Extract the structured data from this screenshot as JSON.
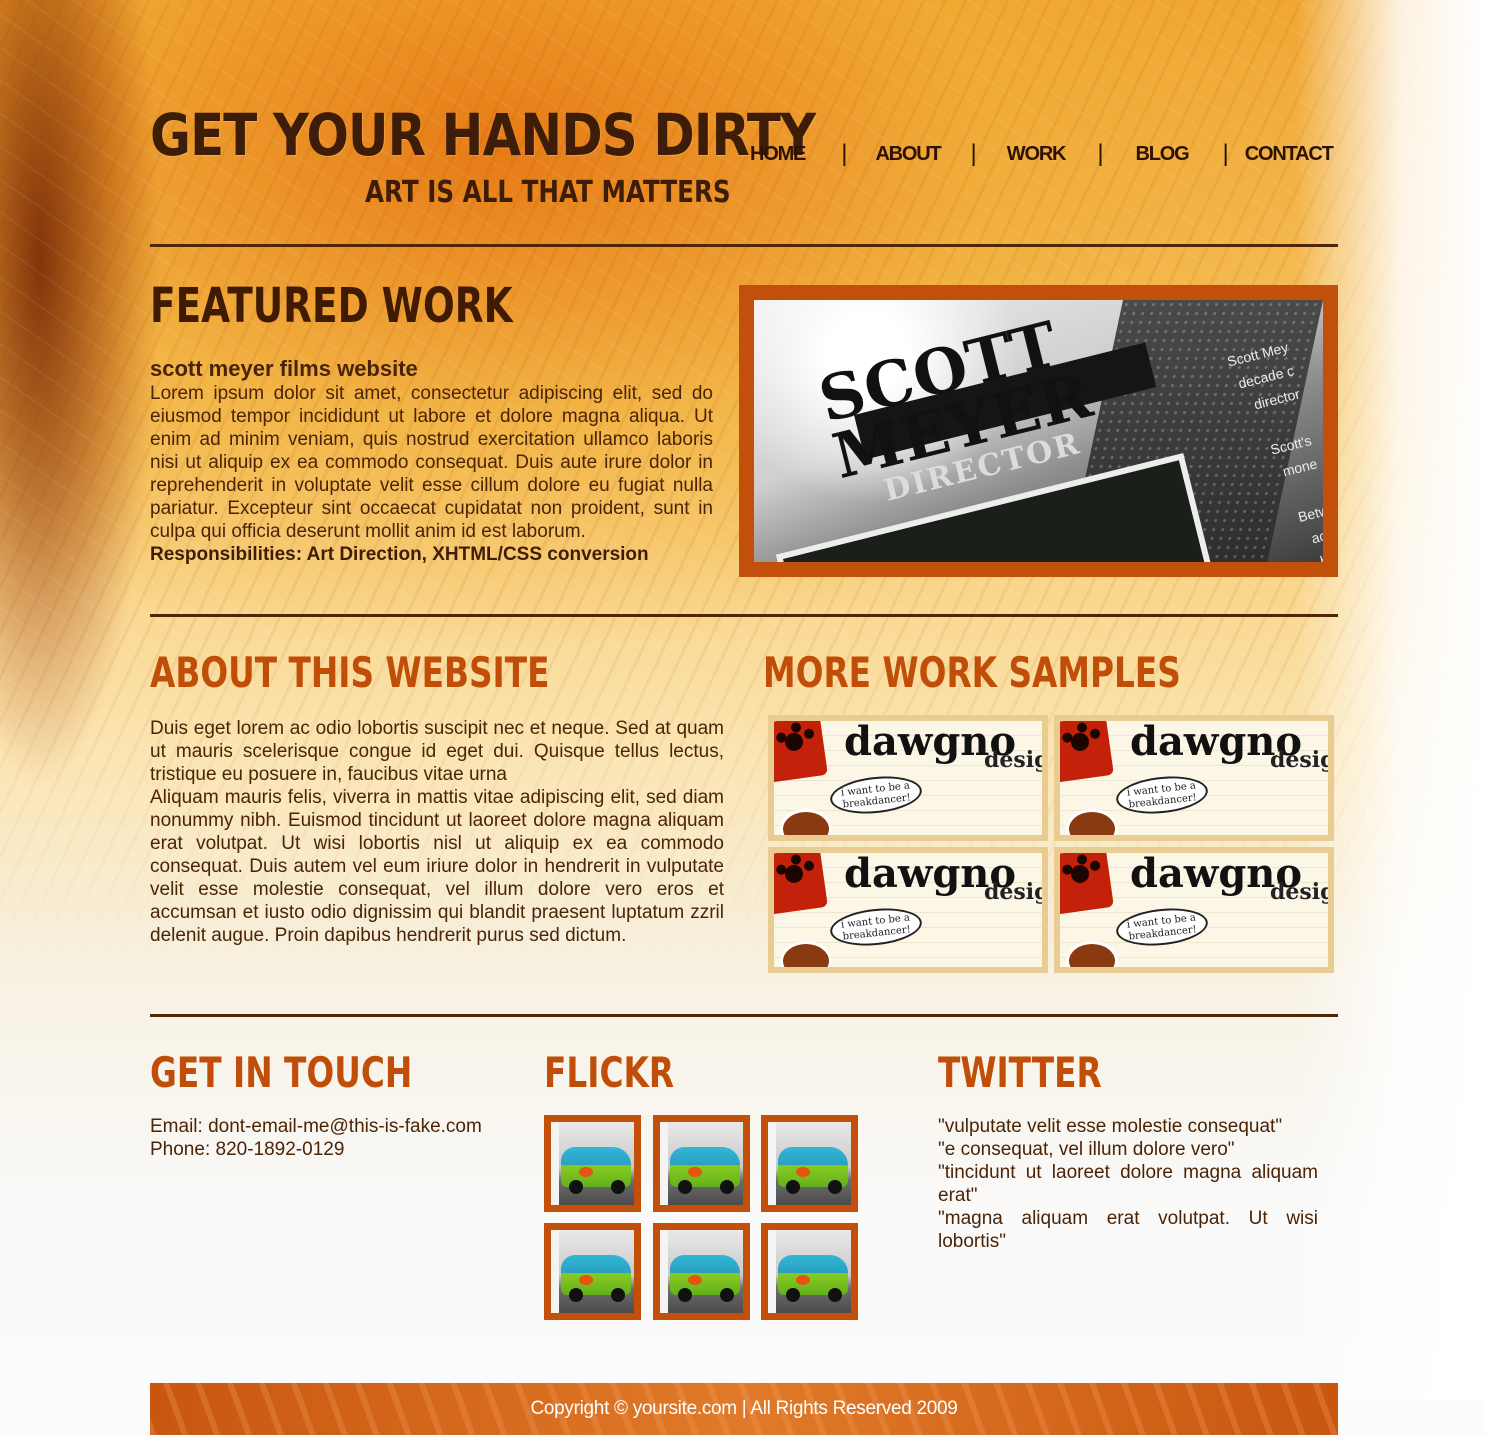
{
  "header": {
    "logo_title": "GET YOUR HANDS DIRTY",
    "logo_tagline": "ART IS ALL THAT MATTERS"
  },
  "nav": {
    "items": [
      "HOME",
      "ABOUT",
      "WORK",
      "BLOG",
      "CONTACT"
    ],
    "separator": "|"
  },
  "featured": {
    "heading": "FEATURED WORK",
    "project_title": "scott meyer films website",
    "description": "Lorem ipsum dolor sit amet, consectetur adipiscing elit, sed do eiusmod tempor incididunt ut labore et dolore magna aliqua. Ut enim ad minim veniam, quis nostrud exercitation ullamco laboris nisi ut aliquip ex ea commodo consequat. Duis aute irure dolor in reprehenderit in voluptate velit esse cillum dolore eu fugiat nulla pariatur. Excepteur sint occaecat cupidatat non proident, sunt in culpa qui officia deserunt mollit anim id est laborum.",
    "responsibilities": "Responsibilities: Art Direction, XHTML/CSS conversion",
    "image": {
      "name": "SCOTT\nMEYER",
      "role": "DIRECTOR",
      "side_text": "Scott Mey\ndecade c\ndirector\n\nScott's\nmone\n\nBetw\nactr\nhor"
    }
  },
  "about": {
    "heading": "ABOUT THIS WEBSITE",
    "paragraph1": "Duis eget lorem ac odio lobortis suscipit nec et neque. Sed at quam ut mauris scelerisque congue id eget dui. Quisque tellus lectus, tristique eu posuere in, faucibus vitae urna",
    "paragraph2": "Aliquam mauris felis, viverra in mattis vitae adipiscing elit, sed diam nonummy nibh. Euismod tincidunt ut laoreet dolore magna aliquam erat volutpat. Ut wisi lobortis nisl ut aliquip ex ea commodo consequat. Duis autem vel eum iriure dolor in hendrerit in vulputate velit esse molestie consequat, vel illum dolore vero eros et accumsan et iusto odio dignissim qui blandit praesent luptatum zzril delenit augue. Proin dapibus hendrerit purus sed dictum."
  },
  "work_samples": {
    "heading": "MORE WORK SAMPLES",
    "thumb": {
      "word": "dawgno",
      "sub": "desig",
      "bubble": "i want to be a breakdancer!"
    },
    "count": 4
  },
  "contact": {
    "heading": "GET IN TOUCH",
    "email": "Email: dont-email-me@this-is-fake.com",
    "phone": "Phone: 820-1892-0129"
  },
  "flickr": {
    "heading": "FLICKR",
    "count": 6
  },
  "twitter": {
    "heading": "TWITTER",
    "tweets": [
      "\"vulputate velit esse molestie consequat\"",
      "\"e consequat, vel illum dolore vero\"",
      "\"tincidunt ut laoreet dolore magna aliquam erat\"",
      "\"magna aliquam erat volutpat. Ut wisi lobortis\""
    ]
  },
  "footer": {
    "copyright": "Copyright © yoursite.com | All Rights Reserved 2009"
  },
  "colors": {
    "accent_orange": "#c2500b",
    "dark_brown": "#3e1d08",
    "thumb_border": "#e9cc91"
  }
}
